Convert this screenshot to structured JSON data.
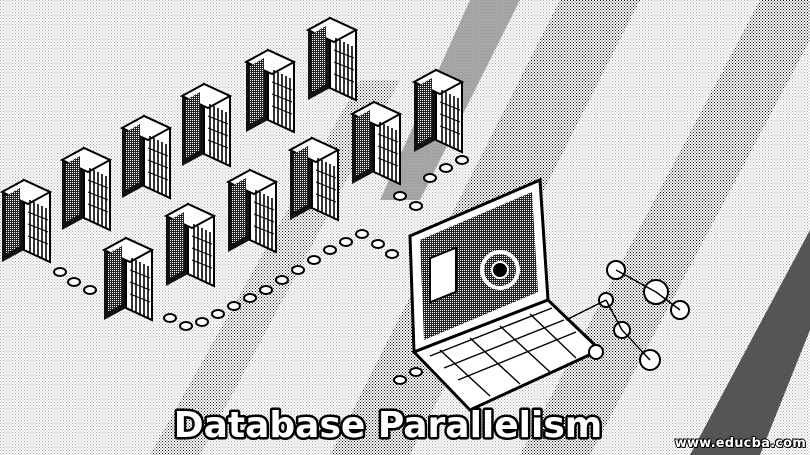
{
  "image": {
    "title": "Database Parallelism",
    "watermark": "www.educba.com",
    "colors": {
      "background": "#ffffff",
      "ink": "#000000",
      "stripe": "#555555",
      "text_fill": "#ffffff"
    },
    "icons": [
      "server-rack-icon",
      "laptop-icon",
      "chain-link-icon",
      "node-circle-icon"
    ]
  }
}
